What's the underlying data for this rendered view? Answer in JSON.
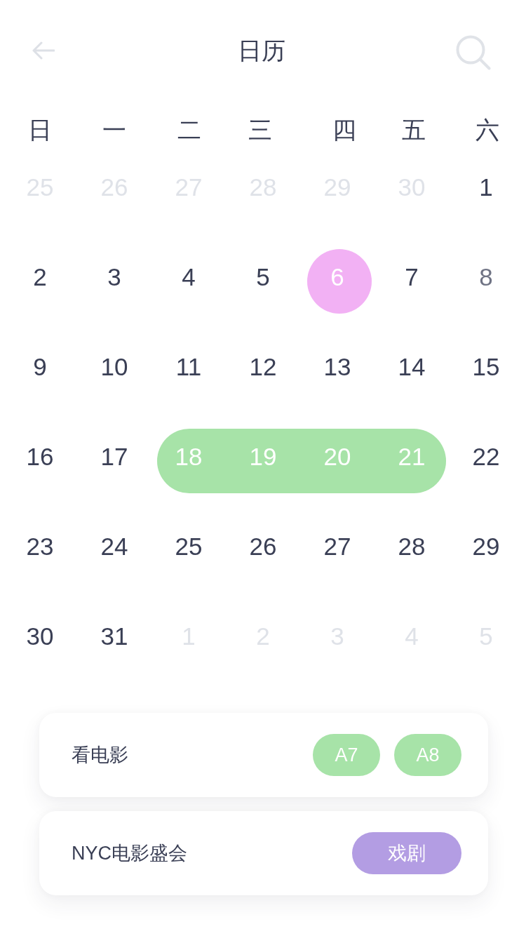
{
  "header": {
    "title": "日历"
  },
  "weekdays": [
    "日",
    "一",
    "二",
    "三",
    "四",
    "五",
    "六"
  ],
  "weeks": [
    {
      "days": [
        {
          "day": "25",
          "kind": "other",
          "selected": false
        },
        {
          "day": "26",
          "kind": "other",
          "selected": false
        },
        {
          "day": "27",
          "kind": "other",
          "selected": false
        },
        {
          "day": "28",
          "kind": "other",
          "selected": false
        },
        {
          "day": "29",
          "kind": "other",
          "selected": false
        },
        {
          "day": "30",
          "kind": "other",
          "selected": false
        },
        {
          "day": "1",
          "kind": "day",
          "selected": false
        }
      ]
    },
    {
      "days": [
        {
          "day": "2",
          "kind": "day",
          "selected": false
        },
        {
          "day": "3",
          "kind": "day",
          "selected": false
        },
        {
          "day": "4",
          "kind": "day",
          "selected": false
        },
        {
          "day": "5",
          "kind": "day",
          "selected": false
        },
        {
          "day": "6",
          "kind": "day",
          "selected": true,
          "color": "#f2b1f4"
        },
        {
          "day": "7",
          "kind": "day",
          "selected": false
        },
        {
          "day": "8",
          "kind": "muted",
          "selected": false
        }
      ]
    },
    {
      "days": [
        {
          "day": "9",
          "kind": "day",
          "selected": false
        },
        {
          "day": "10",
          "kind": "day",
          "selected": false
        },
        {
          "day": "11",
          "kind": "day",
          "selected": false
        },
        {
          "day": "12",
          "kind": "day",
          "selected": false
        },
        {
          "day": "13",
          "kind": "day",
          "selected": false
        },
        {
          "day": "14",
          "kind": "day",
          "selected": false
        },
        {
          "day": "15",
          "kind": "day",
          "selected": false
        }
      ]
    },
    {
      "days": [
        {
          "day": "16",
          "kind": "day",
          "selected": false
        },
        {
          "day": "17",
          "kind": "day",
          "selected": false
        },
        {
          "day": "18",
          "kind": "day",
          "selected": true,
          "color": "#a7e3a8"
        },
        {
          "day": "19",
          "kind": "day",
          "selected": true
        },
        {
          "day": "20",
          "kind": "day",
          "selected": true
        },
        {
          "day": "21",
          "kind": "day",
          "selected": true
        },
        {
          "day": "22",
          "kind": "day",
          "selected": false
        }
      ]
    },
    {
      "days": [
        {
          "day": "23",
          "kind": "day",
          "selected": false
        },
        {
          "day": "24",
          "kind": "day",
          "selected": false
        },
        {
          "day": "25",
          "kind": "day",
          "selected": false
        },
        {
          "day": "26",
          "kind": "day",
          "selected": false
        },
        {
          "day": "27",
          "kind": "day",
          "selected": false
        },
        {
          "day": "28",
          "kind": "day",
          "selected": false
        },
        {
          "day": "29",
          "kind": "day",
          "selected": false
        }
      ]
    },
    {
      "days": [
        {
          "day": "30",
          "kind": "day",
          "selected": false
        },
        {
          "day": "31",
          "kind": "day",
          "selected": false
        },
        {
          "day": "1",
          "kind": "other",
          "selected": false
        },
        {
          "day": "2",
          "kind": "other",
          "selected": false
        },
        {
          "day": "3",
          "kind": "other",
          "selected": false
        },
        {
          "day": "4",
          "kind": "other",
          "selected": false
        },
        {
          "day": "5",
          "kind": "other",
          "selected": false
        }
      ]
    }
  ],
  "events": [
    {
      "title": "看电影",
      "tags": [
        {
          "label": "A7",
          "color": "#a7e3a8"
        },
        {
          "label": "A8",
          "color": "#a7e3a8"
        }
      ]
    },
    {
      "title": "NYC电影盛会",
      "tags": [
        {
          "label": "戏剧",
          "color": "#b39de3"
        }
      ]
    }
  ]
}
